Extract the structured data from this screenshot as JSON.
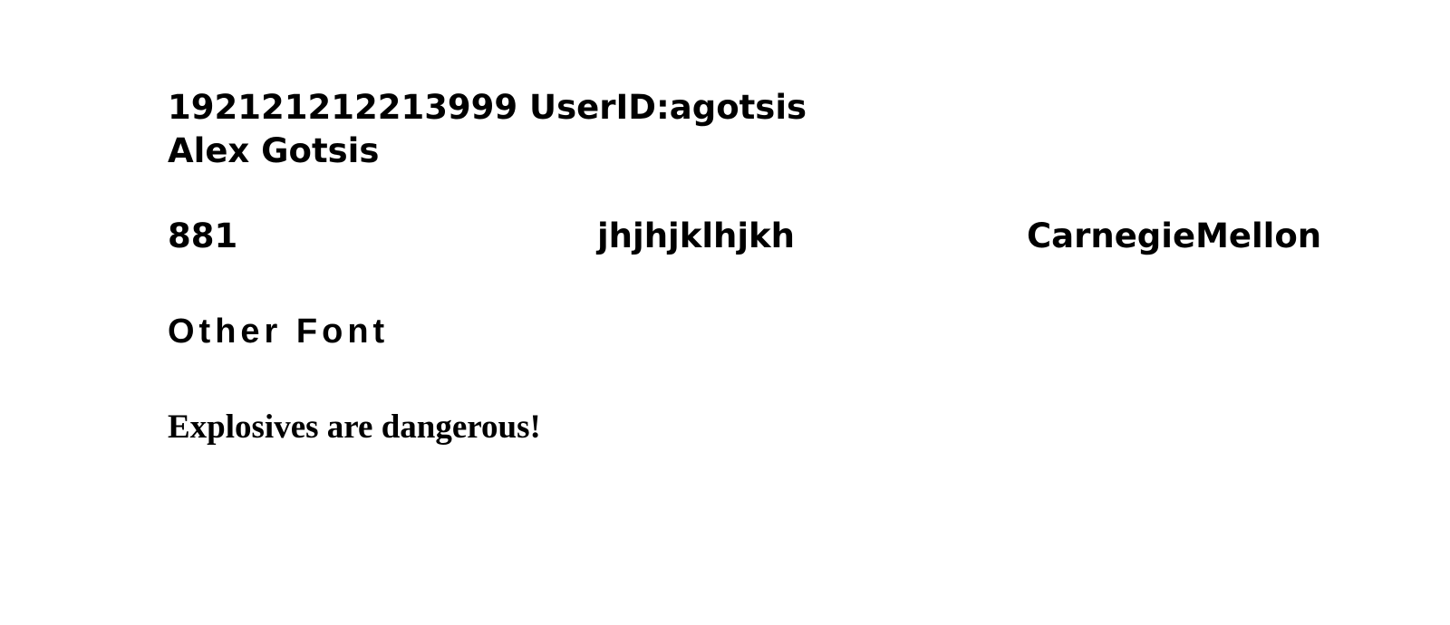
{
  "header": {
    "line1": "192121212213999 UserID:agotsis",
    "line2": "Alex Gotsis"
  },
  "row": {
    "col1": "881",
    "col2": "jhjhjklhjkh",
    "col3": "CarnegieMellon"
  },
  "other_font": "Other Font",
  "warning": "Explosives are dangerous!"
}
